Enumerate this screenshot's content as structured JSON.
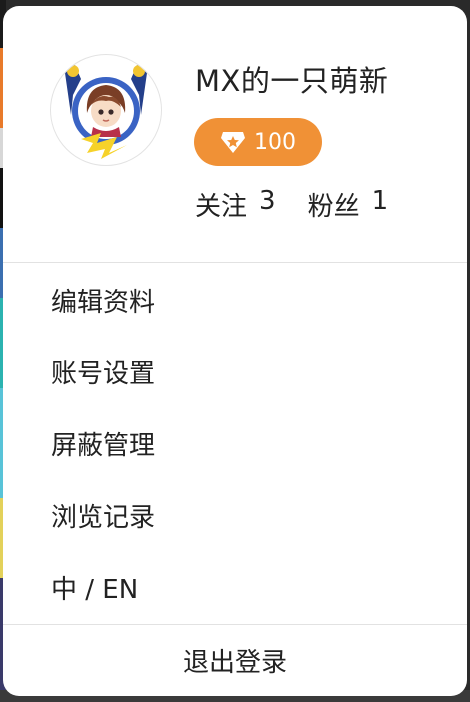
{
  "user": {
    "name": "MX的一只萌新",
    "level": "100",
    "avatar_icon": "anime-avatar-icon"
  },
  "stats": {
    "following_label": "关注",
    "following_count": "3",
    "followers_label": "粉丝",
    "followers_count": "1"
  },
  "menu": {
    "items": [
      {
        "label": "编辑资料"
      },
      {
        "label": "账号设置"
      },
      {
        "label": "屏蔽管理"
      },
      {
        "label": "浏览记录"
      },
      {
        "label": "中 / EN"
      }
    ]
  },
  "logout_label": "退出登录",
  "colors": {
    "badge": "#f09136",
    "panel": "#ffffff",
    "text": "#222222"
  }
}
